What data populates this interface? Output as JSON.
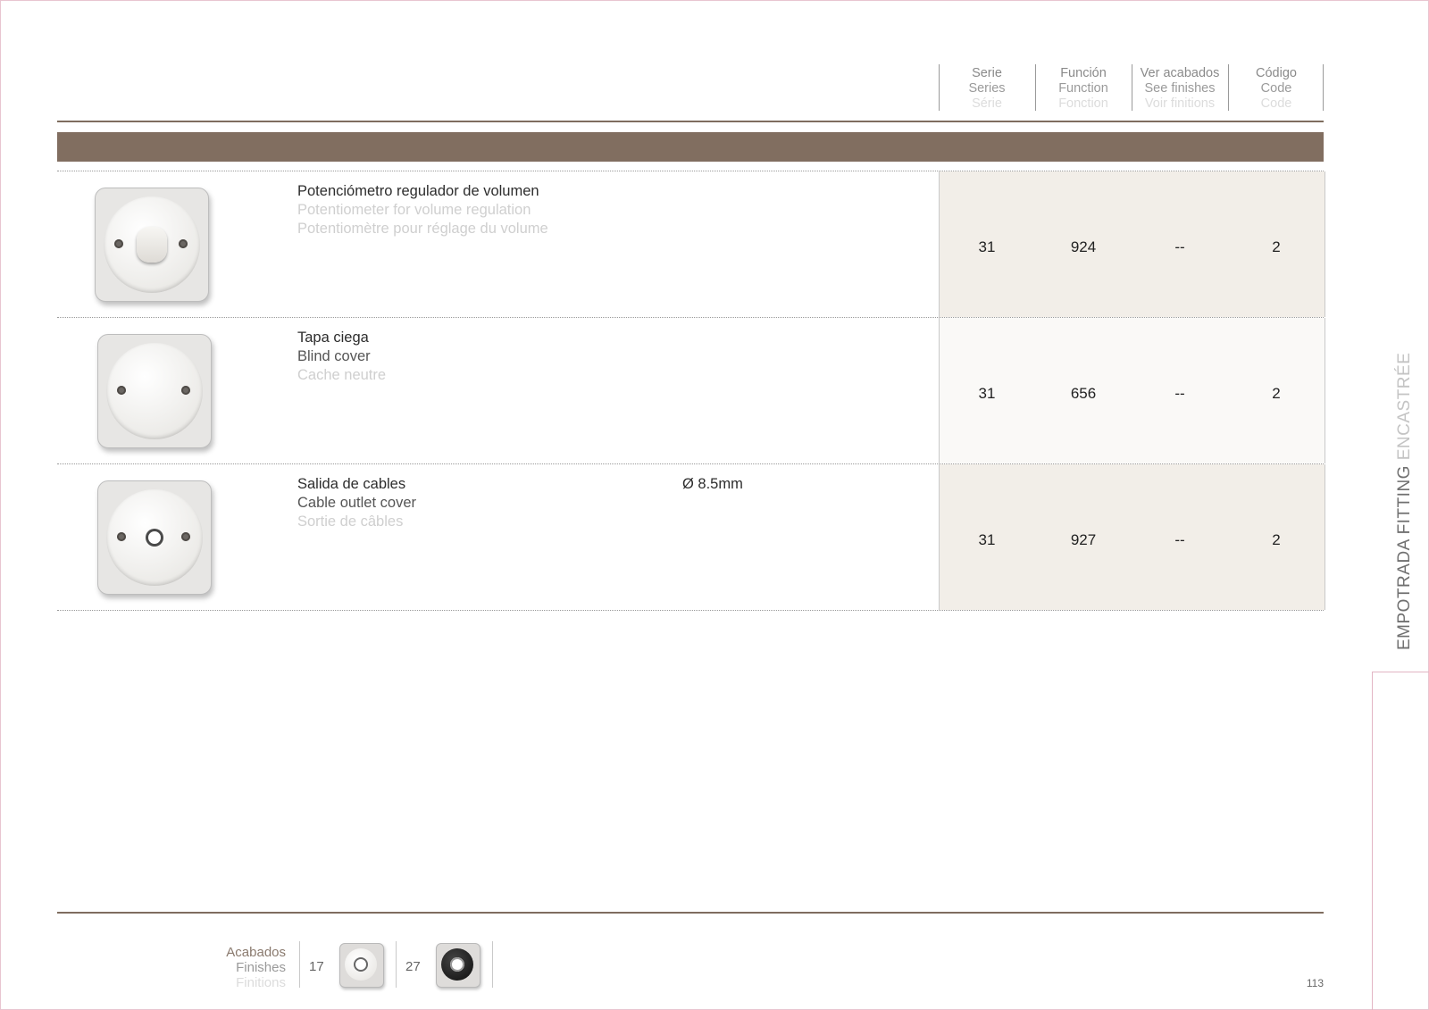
{
  "header": {
    "columns": [
      {
        "es": "Serie",
        "en": "Series",
        "fr": "Série"
      },
      {
        "es": "Función",
        "en": "Function",
        "fr": "Fonction"
      },
      {
        "es": "Ver acabados",
        "en": "See finishes",
        "fr": "Voir finitions"
      },
      {
        "es": "Código",
        "en": "Code",
        "fr": "Code"
      }
    ]
  },
  "products": [
    {
      "name_es": "Potenciómetro regulador de volumen",
      "name_en": "Potentiometer for volume regulation",
      "name_fr": "Potentiomètre pour réglage du volume",
      "spec": "",
      "serie": "31",
      "funcion": "924",
      "acabados": "--",
      "codigo": "2",
      "icon": "volume-knob-icon"
    },
    {
      "name_es": "Tapa ciega",
      "name_en": "Blind cover",
      "name_fr": "Cache neutre",
      "spec": "",
      "serie": "31",
      "funcion": "656",
      "acabados": "--",
      "codigo": "2",
      "icon": "blind-cover-icon"
    },
    {
      "name_es": "Salida de cables",
      "name_en": "Cable outlet cover",
      "name_fr": "Sortie de câbles",
      "spec": "Ø 8.5mm",
      "serie": "31",
      "funcion": "927",
      "acabados": "--",
      "codigo": "2",
      "icon": "cable-outlet-icon"
    }
  ],
  "footer": {
    "finishes_es": "Acabados",
    "finishes_en": "Finishes",
    "finishes_fr": "Finitions",
    "finish_items": [
      {
        "code": "17",
        "icon": "white-finish-icon"
      },
      {
        "code": "27",
        "icon": "black-finish-icon"
      }
    ],
    "page_number": "113"
  },
  "side_tab": {
    "dark": "EMPOTRADA FITTING",
    "light": "ENCASTRÉE"
  },
  "colors": {
    "accent_brown": "#816e60",
    "row_tint": "#f2eee8",
    "tab_pink": "#e2b5c4"
  }
}
